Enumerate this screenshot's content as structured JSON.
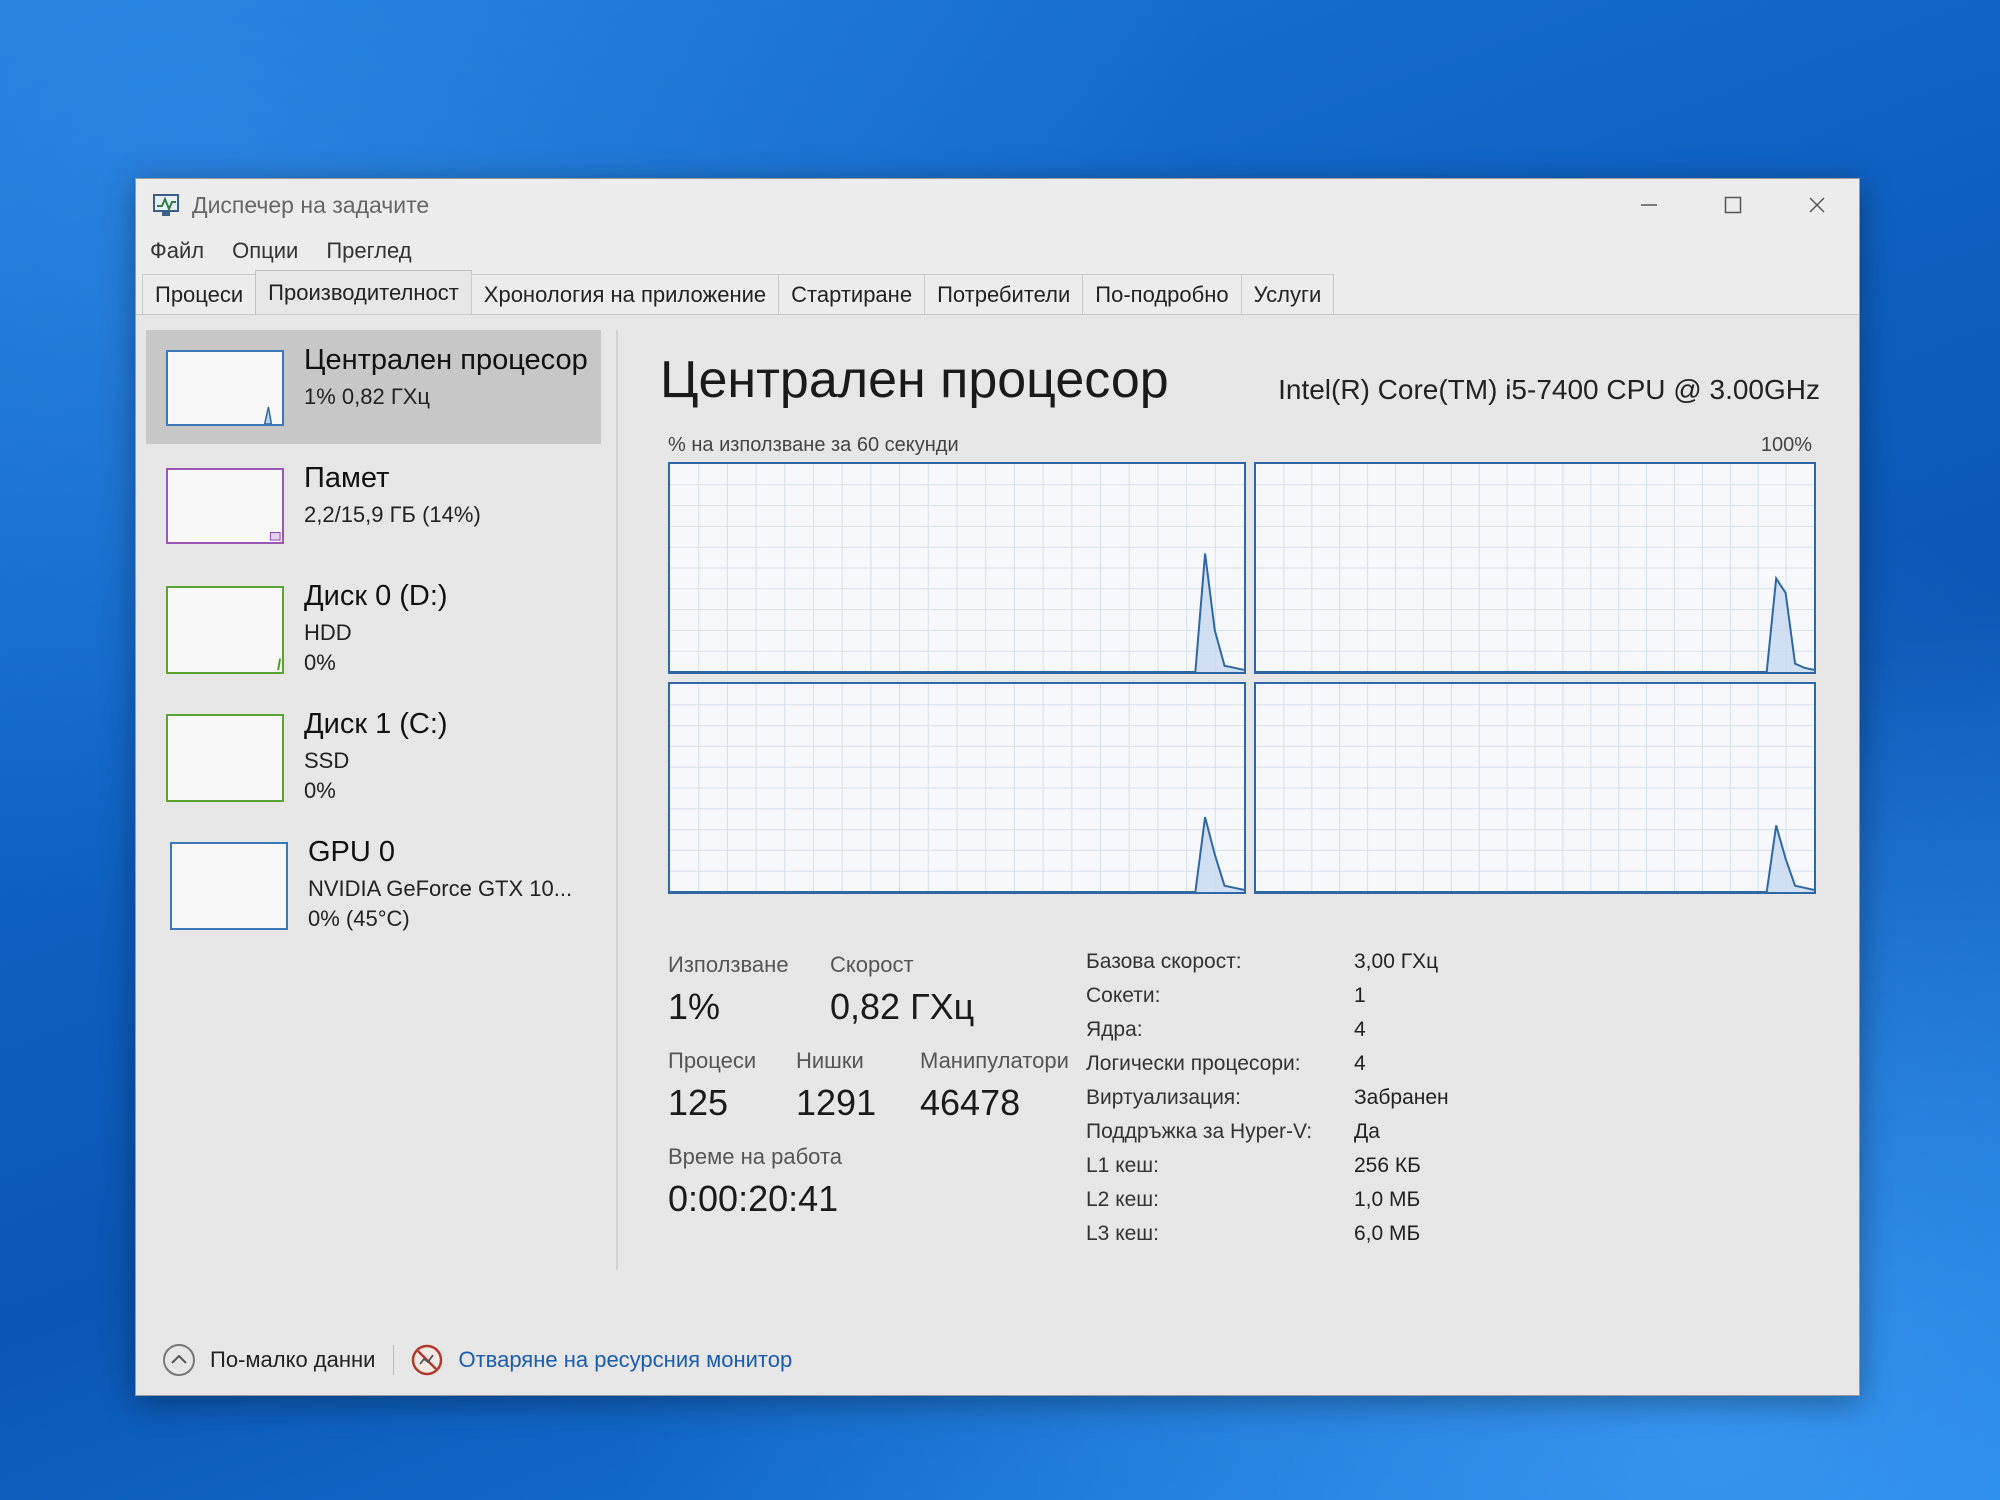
{
  "window": {
    "title": "Диспечер на задачите"
  },
  "menu": [
    "Файл",
    "Опции",
    "Преглед"
  ],
  "tabs": [
    "Процеси",
    "Производителност",
    "Хронология на приложение",
    "Стартиране",
    "Потребители",
    "По-подробно",
    "Услуги"
  ],
  "sidebar": {
    "items": [
      {
        "name": "Централен процесор",
        "line1": "1% 0,82 ГХц",
        "line2": "",
        "color": "#1e6fbf"
      },
      {
        "name": "Памет",
        "line1": "2,2/15,9 ГБ (14%)",
        "line2": "",
        "color": "#8b3fa8"
      },
      {
        "name": "Диск 0 (D:)",
        "line1": "HDD",
        "line2": "0%",
        "color": "#4c9a2a"
      },
      {
        "name": "Диск 1 (C:)",
        "line1": "SSD",
        "line2": "0%",
        "color": "#4c9a2a"
      },
      {
        "name": "GPU 0",
        "line1": "NVIDIA GeForce GTX 10...",
        "line2": "0% (45°C)",
        "color": "#1e6fbf"
      }
    ]
  },
  "main": {
    "title": "Централен процесор",
    "cpu_model": "Intel(R) Core(TM) i5-7400 CPU @ 3.00GHz",
    "graph_caption": "% на използване за 60 секунди",
    "graph_max": "100%"
  },
  "stats": {
    "usage_label": "Използване",
    "usage_value": "1%",
    "speed_label": "Скорост",
    "speed_value": "0,82 ГХц",
    "processes_label": "Процеси",
    "processes_value": "125",
    "threads_label": "Нишки",
    "threads_value": "1291",
    "handles_label": "Манипулатори",
    "handles_value": "46478",
    "uptime_label": "Време на работа",
    "uptime_value": "0:00:20:41"
  },
  "specs": [
    {
      "key": "Базова скорост:",
      "value": "3,00 ГХц"
    },
    {
      "key": "Сокети:",
      "value": "1"
    },
    {
      "key": "Ядра:",
      "value": "4"
    },
    {
      "key": "Логически процесори:",
      "value": "4"
    },
    {
      "key": "Виртуализация:",
      "value": "Забранен"
    },
    {
      "key": "Поддръжка за Hyper-V:",
      "value": "Да"
    },
    {
      "key": "L1 кеш:",
      "value": "256 КБ"
    },
    {
      "key": "L2 кеш:",
      "value": "1,0 МБ"
    },
    {
      "key": "L3 кеш:",
      "value": "6,0 МБ"
    }
  ],
  "footer": {
    "fewer_details": "По-малко данни",
    "resource_monitor": "Отваряне на ресурсния монитор"
  },
  "chart_data": [
    {
      "type": "area",
      "series": [
        {
          "values": [
            0,
            0,
            0,
            0,
            0,
            0,
            0,
            0,
            0,
            0,
            0,
            0,
            0,
            0,
            0,
            0,
            0,
            0,
            0,
            0,
            0,
            0,
            0,
            0,
            0,
            0,
            0,
            0,
            0,
            0,
            0,
            0,
            0,
            0,
            0,
            0,
            0,
            0,
            0,
            0,
            0,
            0,
            0,
            0,
            0,
            0,
            0,
            0,
            0,
            0,
            0,
            0,
            0,
            0,
            0,
            57,
            20,
            3,
            2,
            1
          ]
        }
      ],
      "ylim": [
        0,
        100
      ]
    },
    {
      "type": "area",
      "series": [
        {
          "values": [
            0,
            0,
            0,
            0,
            0,
            0,
            0,
            0,
            0,
            0,
            0,
            0,
            0,
            0,
            0,
            0,
            0,
            0,
            0,
            0,
            0,
            0,
            0,
            0,
            0,
            0,
            0,
            0,
            0,
            0,
            0,
            0,
            0,
            0,
            0,
            0,
            0,
            0,
            0,
            0,
            0,
            0,
            0,
            0,
            0,
            0,
            0,
            0,
            0,
            0,
            0,
            0,
            0,
            0,
            0,
            45,
            38,
            4,
            2,
            1
          ]
        }
      ],
      "ylim": [
        0,
        100
      ]
    },
    {
      "type": "area",
      "series": [
        {
          "values": [
            0,
            0,
            0,
            0,
            0,
            0,
            0,
            0,
            0,
            0,
            0,
            0,
            0,
            0,
            0,
            0,
            0,
            0,
            0,
            0,
            0,
            0,
            0,
            0,
            0,
            0,
            0,
            0,
            0,
            0,
            0,
            0,
            0,
            0,
            0,
            0,
            0,
            0,
            0,
            0,
            0,
            0,
            0,
            0,
            0,
            0,
            0,
            0,
            0,
            0,
            0,
            0,
            0,
            0,
            0,
            36,
            18,
            3,
            2,
            1
          ]
        }
      ],
      "ylim": [
        0,
        100
      ]
    },
    {
      "type": "area",
      "series": [
        {
          "values": [
            0,
            0,
            0,
            0,
            0,
            0,
            0,
            0,
            0,
            0,
            0,
            0,
            0,
            0,
            0,
            0,
            0,
            0,
            0,
            0,
            0,
            0,
            0,
            0,
            0,
            0,
            0,
            0,
            0,
            0,
            0,
            0,
            0,
            0,
            0,
            0,
            0,
            0,
            0,
            0,
            0,
            0,
            0,
            0,
            0,
            0,
            0,
            0,
            0,
            0,
            0,
            0,
            0,
            0,
            0,
            32,
            16,
            3,
            2,
            1
          ]
        }
      ],
      "ylim": [
        0,
        100
      ]
    }
  ]
}
